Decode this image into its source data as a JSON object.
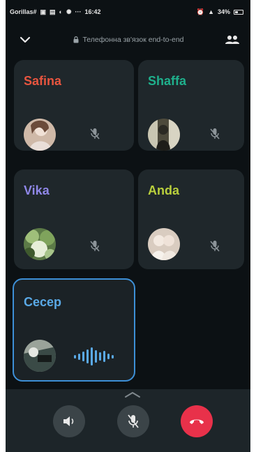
{
  "status_bar": {
    "carrier": "Gorillas#",
    "time": "16:42",
    "battery": "34%"
  },
  "header": {
    "encryption_text": "Телефонна зв'язок end-to-end"
  },
  "participants": [
    {
      "name": "Safina",
      "color": "#e8553f",
      "muted": true
    },
    {
      "name": "Shaffa",
      "color": "#1fb08c",
      "muted": true
    },
    {
      "name": "Vika",
      "color": "#8f87e8",
      "muted": true
    },
    {
      "name": "Anda",
      "color": "#b9cf3c",
      "muted": true
    },
    {
      "name": "Cecep",
      "color": "#5aa9e6",
      "muted": false,
      "speaking": true
    }
  ],
  "controls": {
    "speaker": "speaker-icon",
    "mute": "mic-off-icon",
    "end_call": "end-call-icon",
    "end_call_color": "#e8314a"
  }
}
